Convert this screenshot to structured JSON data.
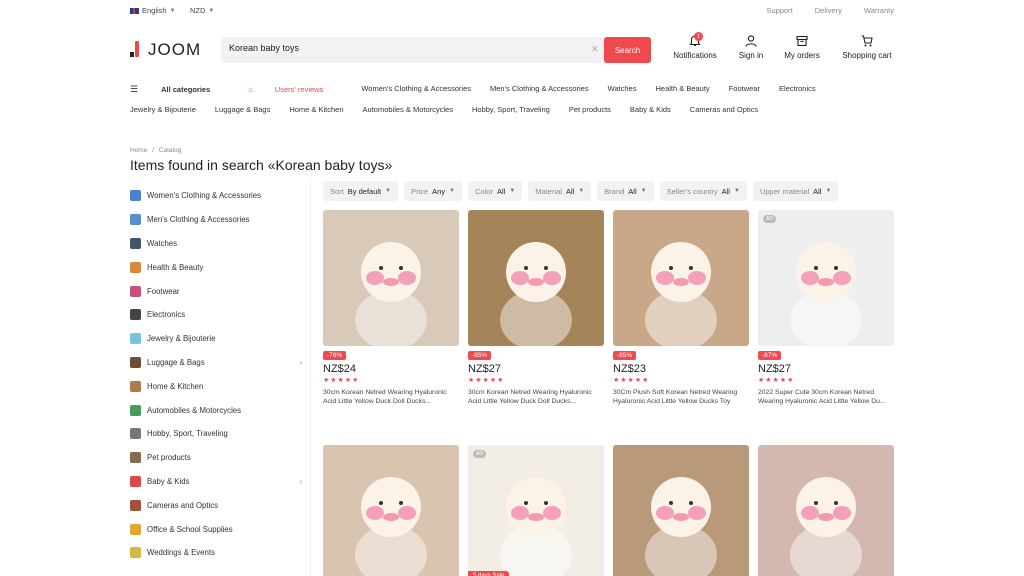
{
  "topbar": {
    "language": "English",
    "currency": "NZD",
    "links": [
      "Support",
      "Delivery",
      "Warranty"
    ]
  },
  "header": {
    "logo": "JOOM",
    "search_value": "Korean baby toys",
    "search_button": "Search",
    "notifications_label": "Notifications",
    "notifications_count": "1",
    "signin_label": "Sign in",
    "orders_label": "My orders",
    "cart_label": "Shopping cart"
  },
  "nav": {
    "all_categories": "All categories",
    "users_reviews": "Users' reviews",
    "row1": [
      "Women's Clothing & Accessories",
      "Men's Clothing & Accessories",
      "Watches",
      "Health & Beauty",
      "Footwear",
      "Electronics"
    ],
    "row2": [
      "Jewelry & Bijouterie",
      "Luggage & Bags",
      "Home & Kitchen",
      "Automobiles & Motorcycles",
      "Hobby, Sport, Traveling",
      "Pet products",
      "Baby & Kids",
      "Cameras and Optics"
    ]
  },
  "breadcrumb": {
    "home": "Home",
    "sep": "/",
    "catalog": "Catalog"
  },
  "page_title": "Items found in search «Korean baby toys»",
  "sidebar": {
    "items": [
      {
        "label": "Women's Clothing & Accessories",
        "icon": "dress-icon",
        "color": "#4a7fd4"
      },
      {
        "label": "Men's Clothing & Accessories",
        "icon": "shirt-icon",
        "color": "#5b8fc9"
      },
      {
        "label": "Watches",
        "icon": "watch-icon",
        "color": "#445566"
      },
      {
        "label": "Health & Beauty",
        "icon": "lipstick-icon",
        "color": "#d9893a"
      },
      {
        "label": "Footwear",
        "icon": "shoe-icon",
        "color": "#c9507a"
      },
      {
        "label": "Electronics",
        "icon": "headphones-icon",
        "color": "#444444"
      },
      {
        "label": "Jewelry & Bijouterie",
        "icon": "diamond-icon",
        "color": "#7ac3e0"
      },
      {
        "label": "Luggage & Bags",
        "icon": "luggage-icon",
        "color": "#6b4f3a"
      },
      {
        "label": "Home & Kitchen",
        "icon": "house-icon",
        "color": "#b07d4a"
      },
      {
        "label": "Automobiles & Motorcycles",
        "icon": "car-icon",
        "color": "#4a9b5c"
      },
      {
        "label": "Hobby, Sport, Traveling",
        "icon": "bicycle-icon",
        "color": "#777777"
      },
      {
        "label": "Pet products",
        "icon": "pet-icon",
        "color": "#8a6a4f"
      },
      {
        "label": "Baby & Kids",
        "icon": "baby-icon",
        "color": "#d94a4a"
      },
      {
        "label": "Cameras and Optics",
        "icon": "camera-icon",
        "color": "#a0523a"
      },
      {
        "label": "Office & School Supplies",
        "icon": "office-icon",
        "color": "#e0a830"
      },
      {
        "label": "Weddings & Events",
        "icon": "ring-icon",
        "color": "#d4b84a"
      }
    ]
  },
  "filters": [
    {
      "label": "Sort",
      "value": "By default"
    },
    {
      "label": "Price",
      "value": "Any"
    },
    {
      "label": "Color",
      "value": "All"
    },
    {
      "label": "Material",
      "value": "All"
    },
    {
      "label": "Brand",
      "value": "All"
    },
    {
      "label": "Seller's country",
      "value": "All"
    },
    {
      "label": "Upper material",
      "value": "All"
    }
  ],
  "products": [
    {
      "discount": "-76%",
      "price": "NZ$24",
      "stars": "★★★★★",
      "name": "30cm Korean Netred Wearing Hyaluronic Acid Little Yellow Duck Doll Ducks...",
      "bg": "#d8c9b8",
      "ad": "",
      "sale": ""
    },
    {
      "discount": "-85%",
      "price": "NZ$27",
      "stars": "★★★★★",
      "name": "30cm Korean Netred Wearing Hyaluronic Acid Little Yellow Duck Doll Ducks...",
      "bg": "#a6845a",
      "ad": "",
      "sale": ""
    },
    {
      "discount": "-85%",
      "price": "NZ$23",
      "stars": "★★★★★",
      "name": "30Cm Plush Soft Korean Netred Wearing Hyaluronic Acid Little Yellow Ducks Toy",
      "bg": "#c9a88a",
      "ad": "",
      "sale": ""
    },
    {
      "discount": "-87%",
      "price": "NZ$27",
      "stars": "★★★★★",
      "name": "2022 Super Cute 30cm Korean Netred Wearing Hyaluronic Acid Little Yellow Du...",
      "bg": "#eeeeee",
      "ad": "AD",
      "sale": ""
    },
    {
      "discount": "",
      "price": "",
      "stars": "",
      "name": "",
      "bg": "#d9c4b0",
      "ad": "",
      "sale": ""
    },
    {
      "discount": "",
      "price": "",
      "stars": "",
      "name": "",
      "bg": "#f2eee6",
      "ad": "AD",
      "sale": "5 days  Sale"
    },
    {
      "discount": "",
      "price": "",
      "stars": "",
      "name": "",
      "bg": "#b89a7a",
      "ad": "",
      "sale": ""
    },
    {
      "discount": "",
      "price": "",
      "stars": "",
      "name": "",
      "bg": "#d4b8b0",
      "ad": "",
      "sale": ""
    }
  ]
}
